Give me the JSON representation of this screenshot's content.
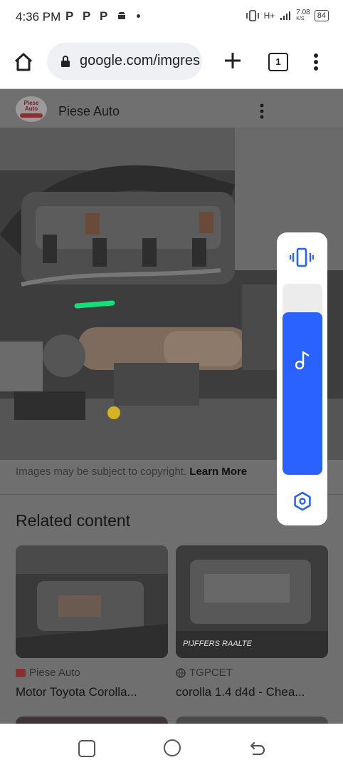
{
  "status_bar": {
    "time": "4:36 PM",
    "notifications": [
      "P",
      "P",
      "P"
    ],
    "network": "H+",
    "speed": "7.08",
    "speed_unit": "K/S",
    "battery": "84"
  },
  "toolbar": {
    "url": "google.com/imgres",
    "tab_count": "1"
  },
  "source": {
    "name": "Piese Auto",
    "logo_text": "Piese Auto"
  },
  "copyright": {
    "text": "Images may be subject to copyright.",
    "link": "Learn More"
  },
  "related": {
    "title": "Related content",
    "cards": [
      {
        "source": "Piese Auto",
        "title": "Motor Toyota Corolla..."
      },
      {
        "source": "TGPCET",
        "title": "corolla 1.4 d4d - Chea..."
      }
    ],
    "thumb_overlay_text": "PIJFFERS RAALTE"
  },
  "volume": {
    "level": 0.85,
    "accent": "#2962ff"
  },
  "icons": [
    "home-icon",
    "lock-icon",
    "plus-icon",
    "more-vert-icon",
    "vibrate-icon",
    "music-note-icon",
    "settings-icon",
    "globe-icon",
    "recent-apps-icon",
    "home-circle-icon",
    "back-icon"
  ]
}
